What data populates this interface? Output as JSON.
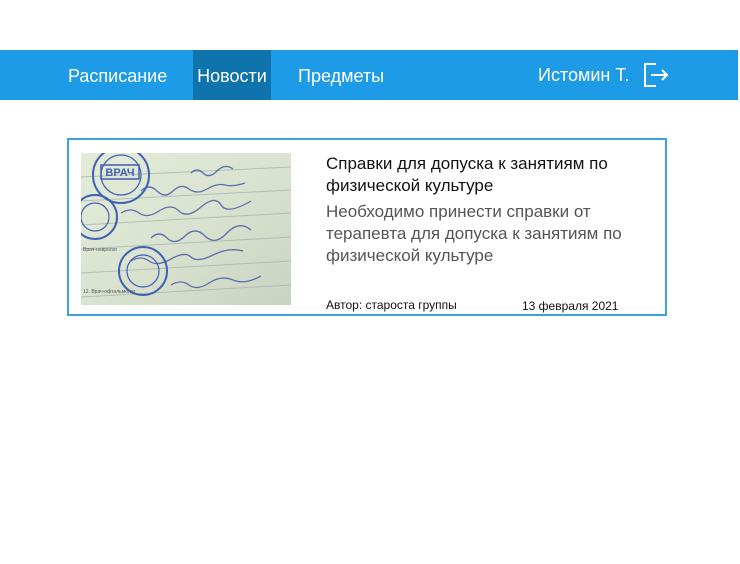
{
  "nav": {
    "items": [
      {
        "label": "Расписание",
        "active": false
      },
      {
        "label": "Новости",
        "active": true
      },
      {
        "label": "Предметы",
        "active": false
      }
    ],
    "user": "Истомин Т.",
    "logout_icon": "logout-icon"
  },
  "news": {
    "items": [
      {
        "title": "Справки для допуска к занятиям по физической культуре",
        "description": "Необходимо принести справки от терапевта для допуска к занятиям по физической культуре",
        "author": "Автор: староста группы",
        "date": "13 февраля 2021",
        "image": {
          "stamp_text": "ВРАЧ"
        }
      }
    ]
  },
  "colors": {
    "nav_bg": "#1d9be6",
    "nav_active_bg": "#0f73ad",
    "card_border": "#3aa4de",
    "stamp": "#3e5fb5"
  }
}
